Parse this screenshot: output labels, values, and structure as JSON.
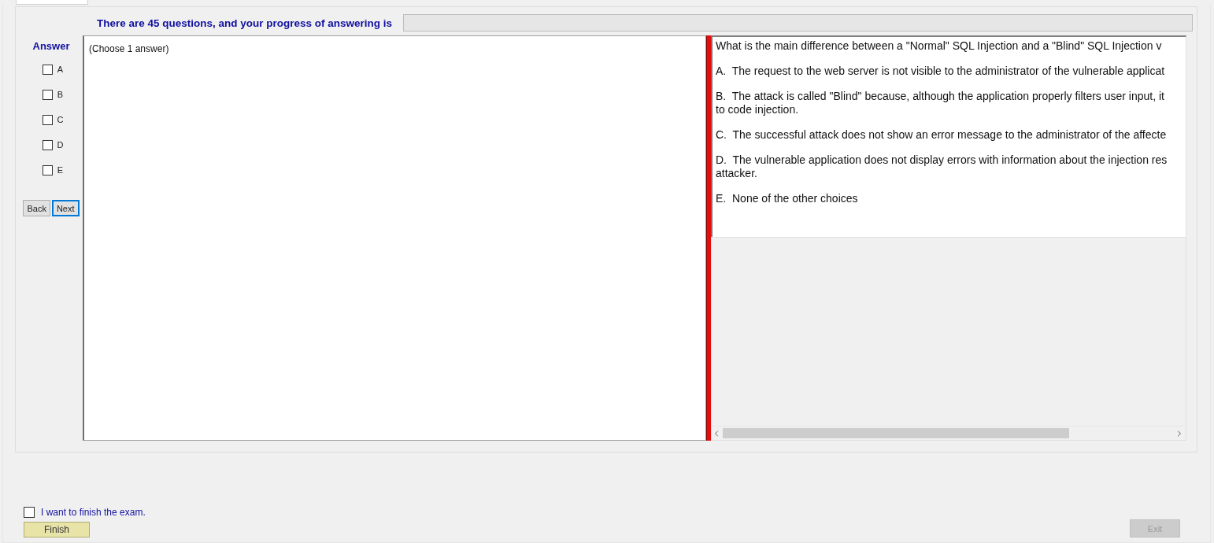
{
  "header": {
    "text": "There are 45 questions, and your progress of answering is",
    "progress_bar": true
  },
  "answer_panel": {
    "title": "Answer",
    "options": [
      {
        "label": "A",
        "checked": false
      },
      {
        "label": "B",
        "checked": false
      },
      {
        "label": "C",
        "checked": false
      },
      {
        "label": "D",
        "checked": false
      },
      {
        "label": "E",
        "checked": false
      }
    ],
    "buttons": [
      {
        "label": "Back",
        "focused": false
      },
      {
        "label": "Next",
        "focused": true
      }
    ]
  },
  "instruction": "(Choose 1 answer)",
  "question": {
    "lines": [
      [
        "What is the main difference between a \"Normal\" SQL Injection and a \"Blind\" SQL Injection v"
      ],
      [
        "A.  The request to the web server is not visible to the administrator of the vulnerable applicat"
      ],
      [
        "B.  The attack is called \"Blind\" because, although the application properly filters user input, it",
        "to code injection."
      ],
      [
        "C.  The successful attack does not show an error message to the administrator of the affecte"
      ],
      [
        "D.  The vulnerable application does not display errors with information about the injection res",
        "attacker."
      ],
      [
        "E.  None of the other choices"
      ]
    ]
  },
  "finish": {
    "label": "I want to finish the exam.",
    "checked": false,
    "button": "Finish"
  },
  "exit": {
    "label": "Exit",
    "disabled": true
  }
}
